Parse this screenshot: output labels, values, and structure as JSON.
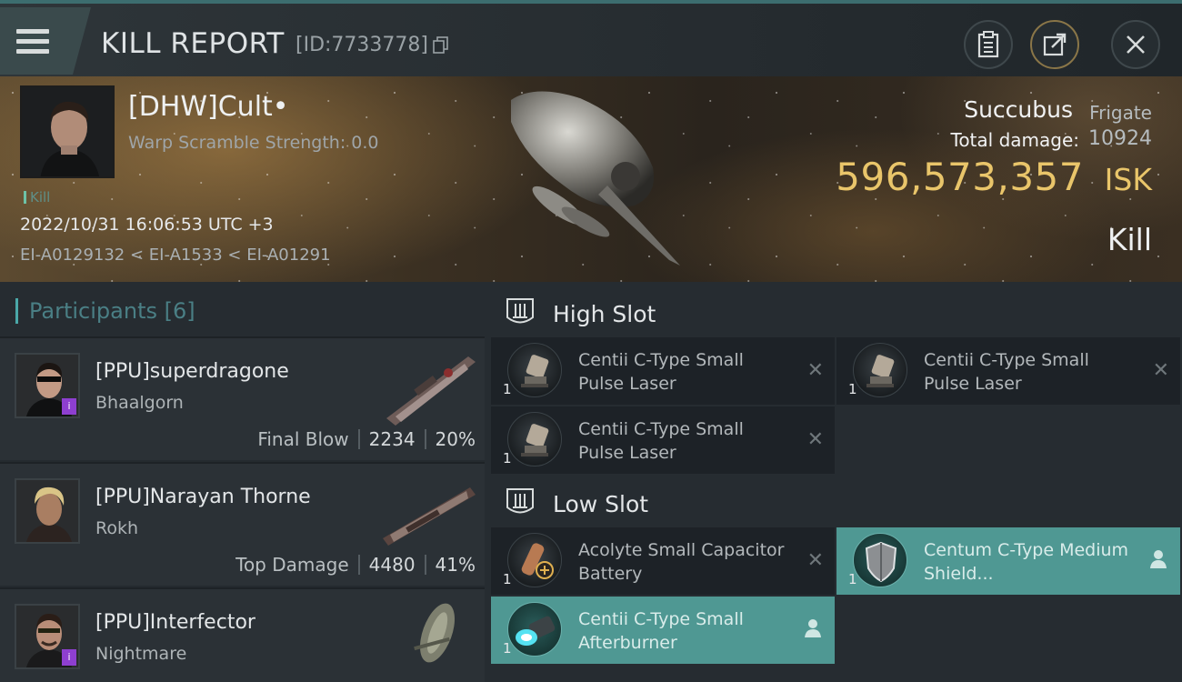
{
  "header": {
    "title": "KILL REPORT",
    "report_id": "[ID:7733778]"
  },
  "victim": {
    "name": "[DHW]Cult•",
    "stat": "Warp Scramble Strength: 0.0",
    "tag": "Kill",
    "timestamp": "2022/10/31 16:06:53 UTC +3",
    "route": "EI-A0129132 < EI-A1533 < EI-A01291"
  },
  "ship": {
    "name": "Succubus",
    "class": "Frigate",
    "damage_label": "Total damage:",
    "damage_value": "10924",
    "isk_value": "596,573,357",
    "isk_unit": "ISK",
    "result": "Kill"
  },
  "participants": {
    "title": "Participants",
    "count": "[6]",
    "items": [
      {
        "name": "[PPU]superdragone",
        "ship": "Bhaalgorn",
        "role": "Final Blow",
        "damage": "2234",
        "percent": "20%",
        "badge": true
      },
      {
        "name": "[PPU]Narayan Thorne",
        "ship": "Rokh",
        "role": "Top Damage",
        "damage": "4480",
        "percent": "41%",
        "badge": false
      },
      {
        "name": "[PPU]Interfector",
        "ship": "Nightmare",
        "role": "",
        "damage": "",
        "percent": "",
        "badge": true
      }
    ]
  },
  "fitting": {
    "high_slot": {
      "label": "High Slot",
      "modules": [
        {
          "qty": "1",
          "name": "Centii C-Type Small Pulse Laser",
          "state": "destroyed"
        },
        {
          "qty": "1",
          "name": "Centii C-Type Small Pulse Laser",
          "state": "destroyed"
        },
        {
          "qty": "1",
          "name": "Centii C-Type Small Pulse Laser",
          "state": "destroyed"
        }
      ]
    },
    "low_slot": {
      "label": "Low Slot",
      "modules": [
        {
          "qty": "1",
          "name": "Acolyte Small Capacitor Battery",
          "state": "destroyed"
        },
        {
          "qty": "1",
          "name": "Centum C-Type Medium Shield...",
          "state": "dropped"
        },
        {
          "qty": "1",
          "name": "Centii C-Type Small Afterburner",
          "state": "dropped"
        }
      ]
    }
  },
  "colors": {
    "accent": "#4f9893",
    "isk": "#e9c56a",
    "badge": "#8e3fd0"
  },
  "icons": [
    "menu-icon",
    "copy-icon",
    "clipboard-icon",
    "share-icon",
    "close-icon",
    "slot-icon",
    "x-icon",
    "person-icon"
  ]
}
